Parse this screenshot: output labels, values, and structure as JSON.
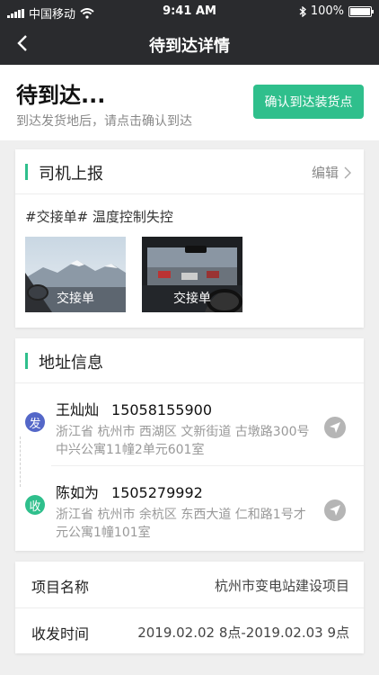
{
  "status_bar": {
    "carrier": "中国移动",
    "time": "9:41 AM",
    "battery": "100%"
  },
  "nav": {
    "title": "待到达详情"
  },
  "header": {
    "title": "待到达...",
    "subtitle": "到达发货地后，请点击确认到达",
    "confirm_label": "确认到达装货点"
  },
  "driver_report": {
    "title": "司机上报",
    "edit_label": "编辑",
    "tags": "#交接单# 温度控制失控",
    "photos": [
      {
        "caption": "交接单"
      },
      {
        "caption": "交接单"
      }
    ]
  },
  "address": {
    "title": "地址信息",
    "sender": {
      "badge": "发",
      "name": "王灿灿",
      "phone": "15058155900",
      "address": "浙江省 杭州市 西湖区 文新街道 古墩路300号中兴公寓11幢2单元601室"
    },
    "receiver": {
      "badge": "收",
      "name": "陈如为",
      "phone": "1505279992",
      "address": "浙江省 杭州市 余杭区 东西大道 仁和路1号才元公寓1幢101室"
    }
  },
  "details": [
    {
      "key": "项目名称",
      "value": "杭州市变电站建设项目"
    },
    {
      "key": "收发时间",
      "value": "2019.02.02 8点-2019.02.03 9点"
    }
  ],
  "colors": {
    "accent": "#2fbf8c",
    "sender_badge": "#5467c8",
    "receiver_badge": "#2fbf8c",
    "topbar": "#2a2b2e"
  }
}
